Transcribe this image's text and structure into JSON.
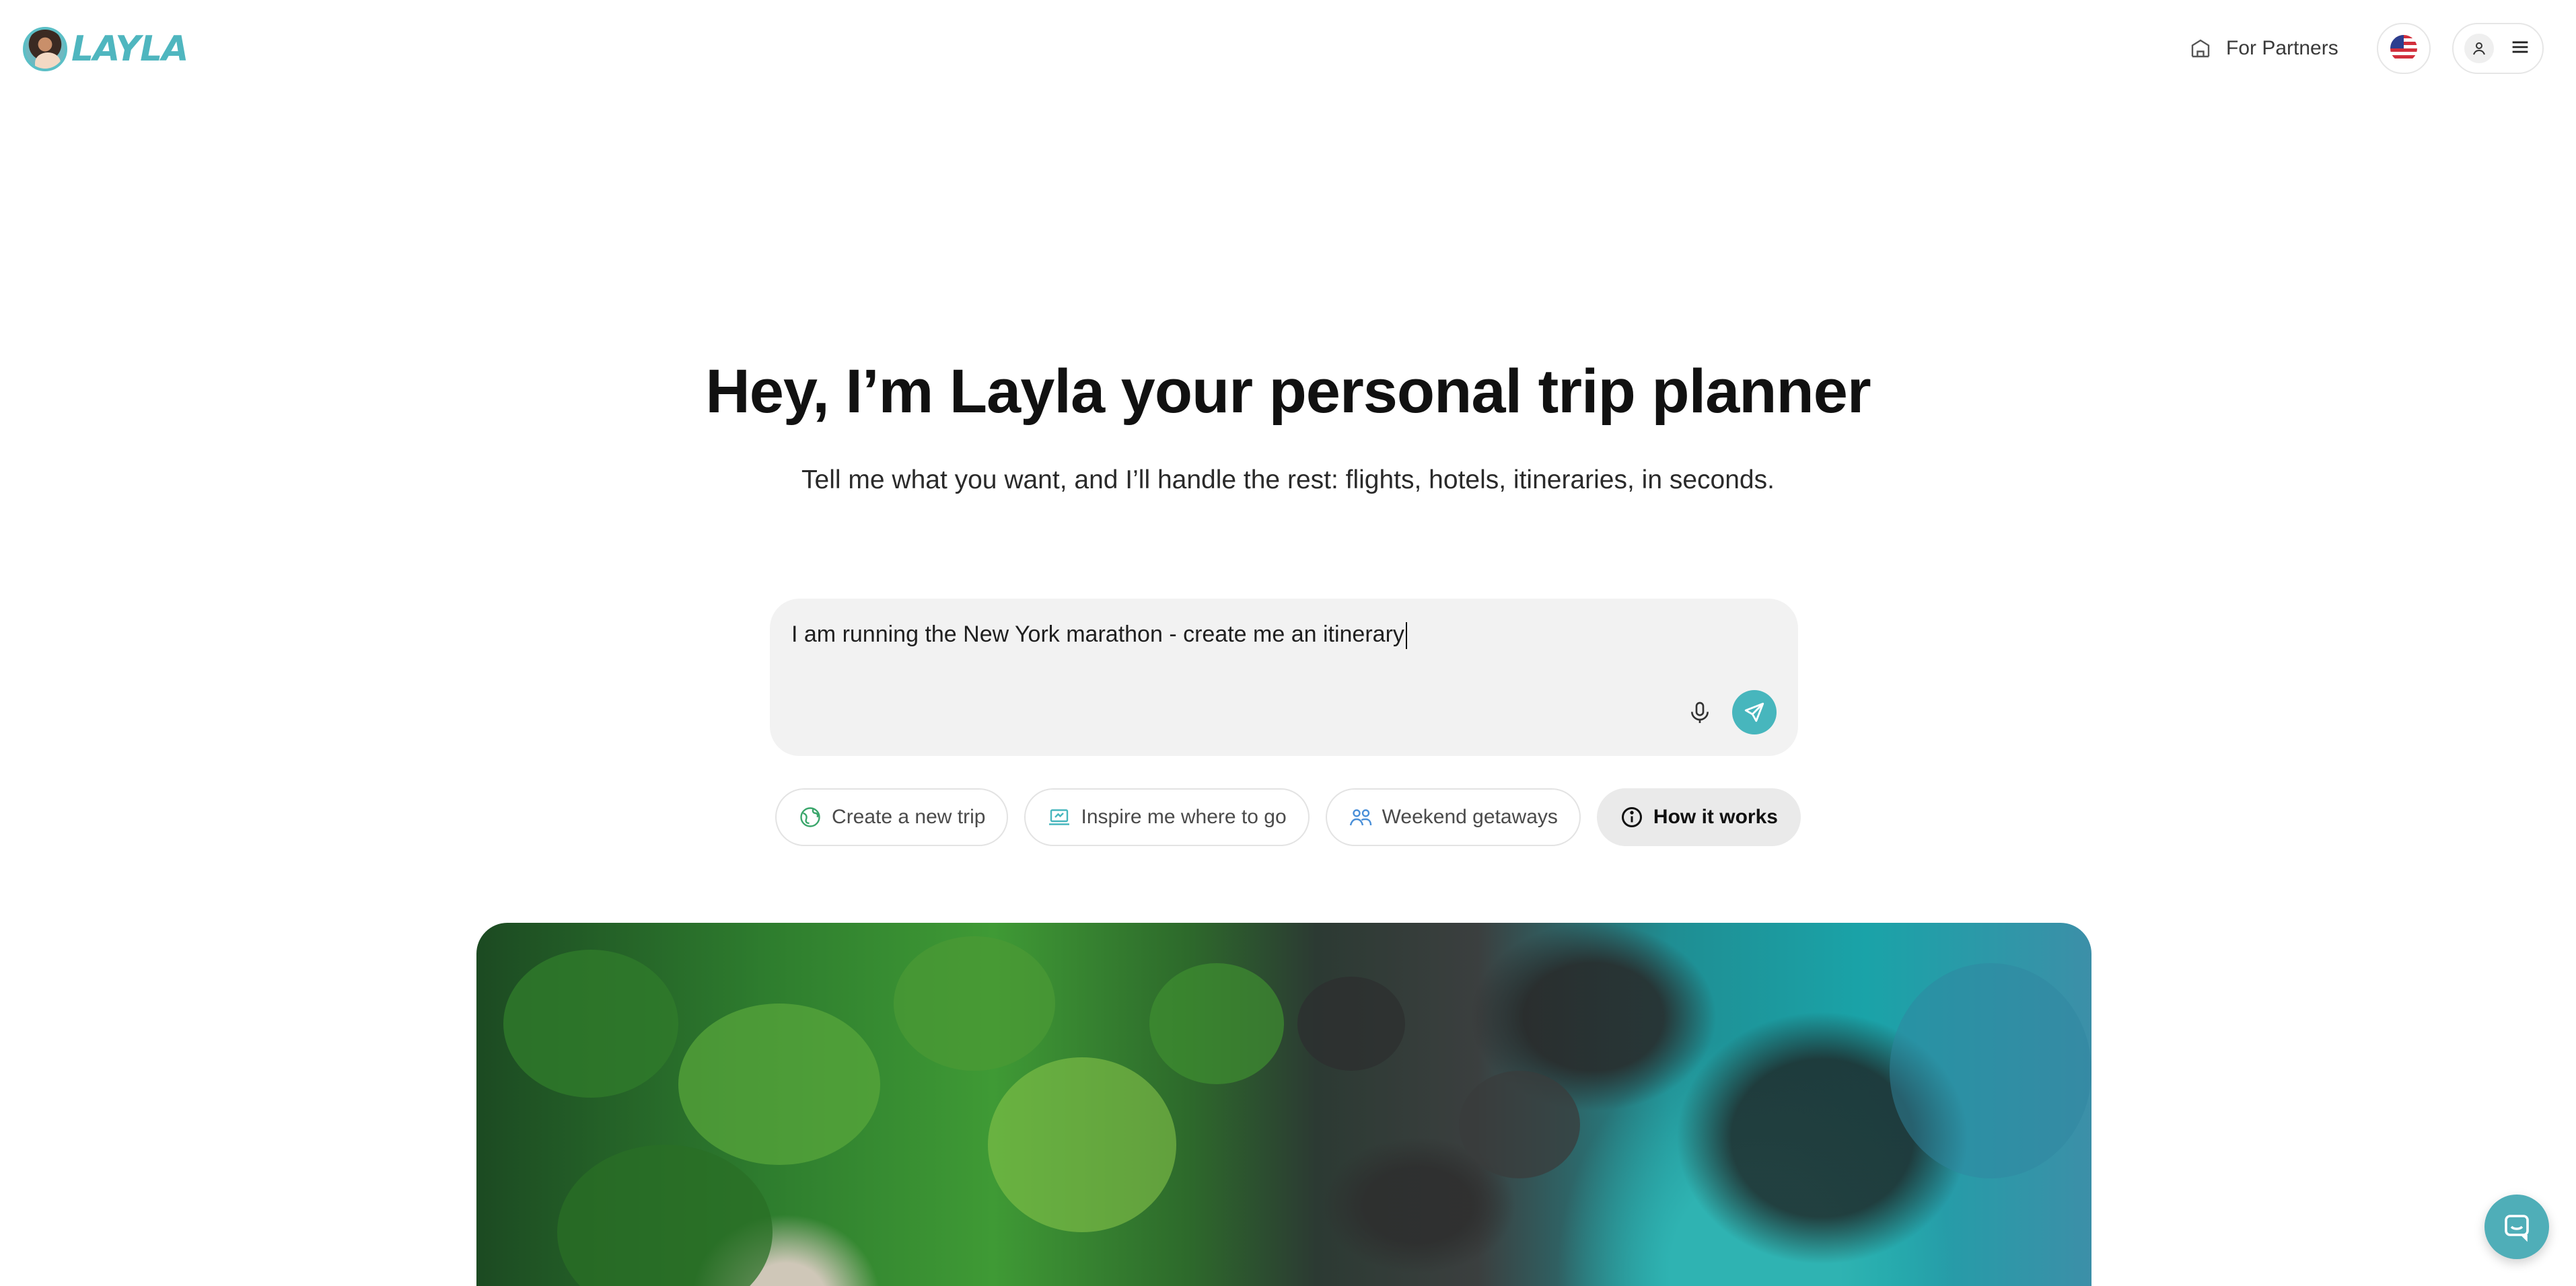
{
  "header": {
    "brand": "LAYLA",
    "partners_label": "For Partners",
    "language_flag": "us-flag-icon"
  },
  "hero": {
    "title": "Hey, I’m Layla your personal trip planner",
    "subtitle": "Tell me what you want, and I’ll handle the rest: flights, hotels, itineraries, in seconds."
  },
  "chat": {
    "input_value": "I am running the New York marathon - create me an itinerary",
    "mic_icon": "microphone-icon",
    "send_icon": "send-icon"
  },
  "chips": [
    {
      "label": "Create a new trip",
      "icon": "globe-icon"
    },
    {
      "label": "Inspire me where to go",
      "icon": "laptop-icon"
    },
    {
      "label": "Weekend getaways",
      "icon": "people-icon"
    },
    {
      "label": "How it works",
      "icon": "info-icon"
    }
  ],
  "colors": {
    "accent": "#47b6bd",
    "chip_active_bg": "#eaeaea",
    "input_bg": "#f2f2f2"
  }
}
